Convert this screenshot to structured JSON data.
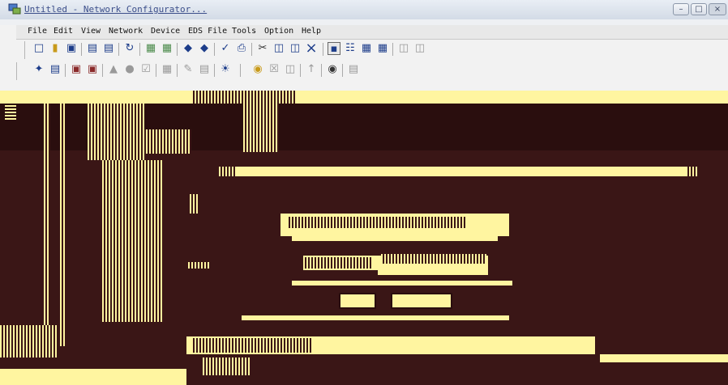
{
  "window": {
    "title": "Untitled - Network Configurator...",
    "min_icon": "minimize-icon",
    "max_icon": "maximize-icon"
  },
  "menubar": {
    "items": [
      "File",
      "Edit",
      "View",
      "Network",
      "Device",
      "EDS File",
      "Tools",
      "Option",
      "Help"
    ]
  },
  "toolbar1": {
    "icons": [
      "new-file-icon",
      "open-folder-icon",
      "save-icon",
      "connect-icon",
      "disconnect-icon",
      "upload-icon",
      "download-icon",
      "monitor-icon",
      "compare-icon",
      "print-icon",
      "cut-icon",
      "copy-icon",
      "paste-icon",
      "delete-icon",
      "large-icons-icon",
      "small-icons-icon",
      "list-icon",
      "details-icon",
      "zoom-in-icon",
      "zoom-out-icon"
    ]
  },
  "toolbar2": {
    "icons": [
      "properties-icon",
      "parameters-icon",
      "register-device-icon",
      "unregister-icon",
      "up-icon",
      "down-icon",
      "check-icon",
      "io-comment-icon",
      "maintenance-icon",
      "mode-icon",
      "online-icon",
      "find-icon",
      "filter-icon",
      "help-icon"
    ]
  },
  "colors": {
    "background": "#2a0e0e",
    "highlight": "#fff5a0",
    "menubar": "#e8e8e8",
    "titlebar": "#d3dbe6"
  }
}
